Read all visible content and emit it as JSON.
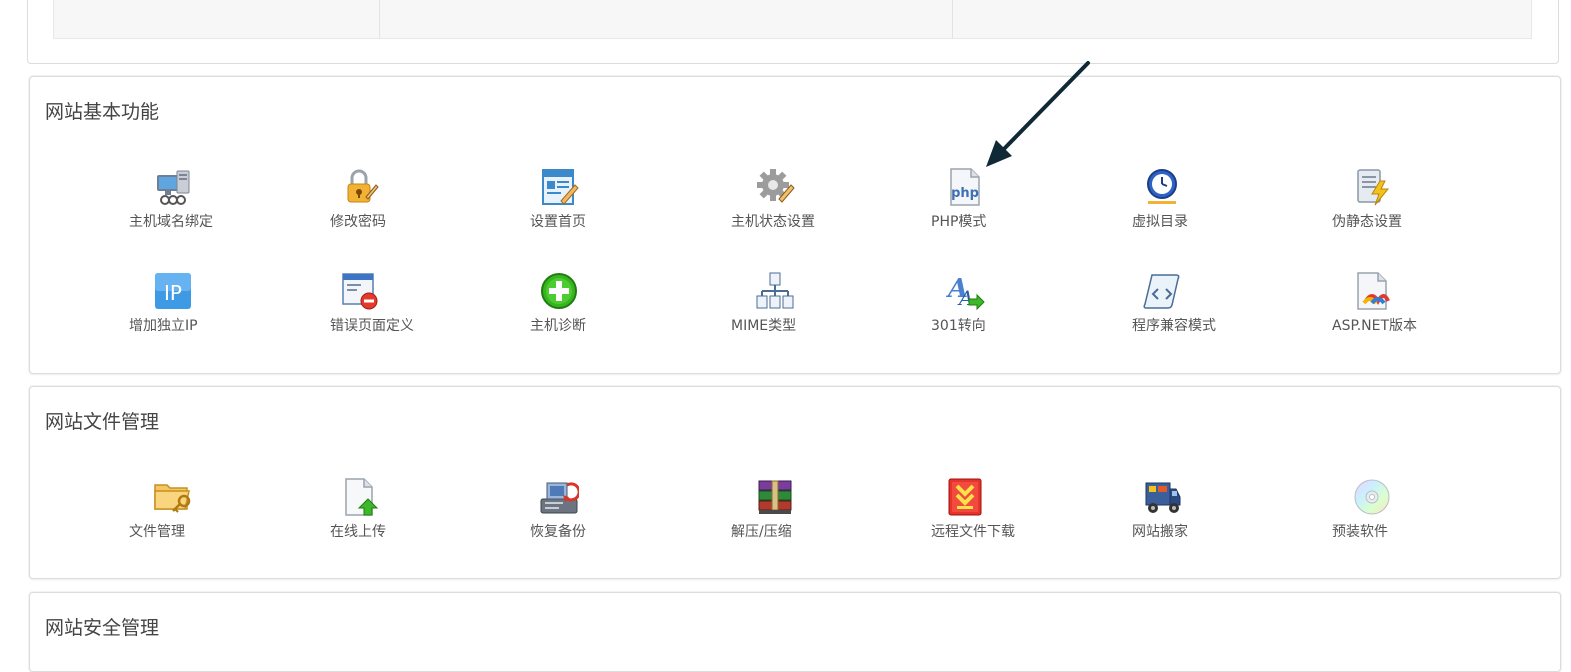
{
  "sections": [
    {
      "title": "网站基本功能",
      "rows": [
        [
          {
            "label": "主机域名绑定",
            "icon": "computer-network-icon"
          },
          {
            "label": "修改密码",
            "icon": "lock-edit-icon"
          },
          {
            "label": "设置首页",
            "icon": "page-edit-icon"
          },
          {
            "label": "主机状态设置",
            "icon": "gear-edit-icon"
          },
          {
            "label": "PHP模式",
            "icon": "php-file-icon"
          },
          {
            "label": "虚拟目录",
            "icon": "clock-globe-icon"
          },
          {
            "label": "伪静态设置",
            "icon": "document-lightning-icon"
          }
        ],
        [
          {
            "label": "增加独立IP",
            "icon": "ip-badge-icon"
          },
          {
            "label": "错误页面定义",
            "icon": "window-error-icon"
          },
          {
            "label": "主机诊断",
            "icon": "green-plus-icon"
          },
          {
            "label": "MIME类型",
            "icon": "sitemap-icon"
          },
          {
            "label": "301转向",
            "icon": "font-arrow-icon"
          },
          {
            "label": "程序兼容模式",
            "icon": "scroll-code-icon"
          },
          {
            "label": "ASP.NET版本",
            "icon": "dotnet-file-icon"
          }
        ]
      ]
    },
    {
      "title": "网站文件管理",
      "rows": [
        [
          {
            "label": "文件管理",
            "icon": "folder-key-icon"
          },
          {
            "label": "在线上传",
            "icon": "file-upload-icon"
          },
          {
            "label": "恢复备份",
            "icon": "backup-restore-icon"
          },
          {
            "label": "解压/压缩",
            "icon": "archive-books-icon"
          },
          {
            "label": "远程文件下载",
            "icon": "red-download-icon"
          },
          {
            "label": "网站搬家",
            "icon": "moving-truck-icon"
          },
          {
            "label": "预装软件",
            "icon": "cd-disc-icon"
          }
        ]
      ]
    },
    {
      "title": "网站安全管理",
      "rows": []
    }
  ],
  "colors": {
    "panel_border": "#dcdcdc",
    "text": "#555555",
    "title": "#444444",
    "arrow": "#0f2a36"
  }
}
